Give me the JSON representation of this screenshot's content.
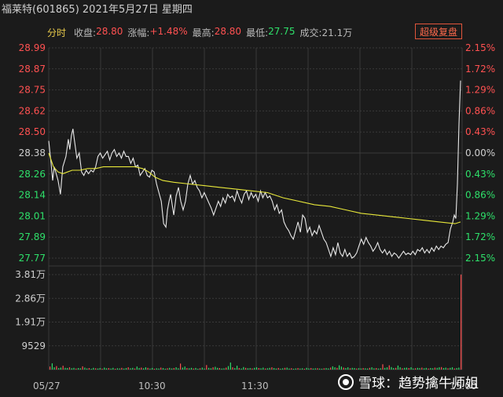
{
  "title": "福莱特(601865) 2021年5月27日 星期四",
  "header": {
    "tab_label": "分时",
    "close_label": "收盘:",
    "close_value": "28.80",
    "change_label": "涨幅:",
    "change_value": "+1.48%",
    "high_label": "最高:",
    "high_value": "28.80",
    "low_label": "最低:",
    "low_value": "27.75",
    "volume_label": "成交:",
    "volume_value": "21.1万",
    "super_button": "超级复盘"
  },
  "colors": {
    "background": "#1b1b1b",
    "grid": "#3a3a3a",
    "up": "#ff5151",
    "down": "#2ee06a",
    "neutral": "#cfcfcf",
    "price_line": "#e8e8e8",
    "avg_line": "#e8e83a"
  },
  "footer": {
    "date_label": "05/27",
    "t1030": "10:30",
    "t1130": "11:30",
    "t1500": "15:00"
  },
  "watermark": "雪球：趋势擒牛师姐",
  "chart_data": [
    {
      "type": "line",
      "prev_close": 28.38,
      "ylim": [
        27.77,
        28.99
      ],
      "y_ticks": [
        "28.99",
        "28.87",
        "28.75",
        "28.62",
        "28.50",
        "28.38",
        "28.26",
        "28.14",
        "28.01",
        "27.89",
        "27.77"
      ],
      "pct_ticks": [
        "2.15%",
        "1.72%",
        "1.29%",
        "0.86%",
        "0.43%",
        "0.00%",
        "0.43%",
        "0.86%",
        "1.29%",
        "1.72%",
        "2.15%"
      ],
      "x_tick_labels": [
        "05/27",
        "10:30",
        "11:30",
        "15:00"
      ],
      "series": [
        {
          "role": "price",
          "points": [
            [
              0,
              28.45
            ],
            [
              3,
              28.32
            ],
            [
              5,
              28.22
            ],
            [
              7,
              28.3
            ],
            [
              9,
              28.27
            ],
            [
              12,
              28.22
            ],
            [
              15,
              28.14
            ],
            [
              18,
              28.3
            ],
            [
              22,
              28.36
            ],
            [
              25,
              28.46
            ],
            [
              27,
              28.4
            ],
            [
              29,
              28.48
            ],
            [
              31,
              28.52
            ],
            [
              33,
              28.45
            ],
            [
              36,
              28.35
            ],
            [
              39,
              28.38
            ],
            [
              42,
              28.27
            ],
            [
              45,
              28.25
            ],
            [
              48,
              28.28
            ],
            [
              51,
              28.26
            ],
            [
              54,
              28.28
            ],
            [
              57,
              28.27
            ],
            [
              60,
              28.3
            ],
            [
              63,
              28.36
            ],
            [
              66,
              28.38
            ],
            [
              69,
              28.35
            ],
            [
              72,
              28.37
            ],
            [
              75,
              28.39
            ],
            [
              78,
              28.34
            ],
            [
              81,
              28.38
            ],
            [
              84,
              28.4
            ],
            [
              87,
              28.36
            ],
            [
              90,
              28.38
            ],
            [
              93,
              28.35
            ],
            [
              96,
              28.39
            ],
            [
              99,
              28.36
            ],
            [
              102,
              28.36
            ],
            [
              105,
              28.32
            ],
            [
              108,
              28.35
            ],
            [
              111,
              28.3
            ],
            [
              114,
              28.31
            ],
            [
              117,
              28.25
            ],
            [
              120,
              28.27
            ],
            [
              123,
              28.29
            ],
            [
              126,
              28.25
            ],
            [
              129,
              28.24
            ],
            [
              132,
              28.28
            ],
            [
              135,
              28.27
            ],
            [
              138,
              28.2
            ],
            [
              141,
              28.15
            ],
            [
              144,
              28.1
            ],
            [
              147,
              27.97
            ],
            [
              150,
              27.95
            ],
            [
              152,
              28.05
            ],
            [
              154,
              28.1
            ],
            [
              156,
              28.14
            ],
            [
              158,
              28.08
            ],
            [
              160,
              28.02
            ],
            [
              163,
              28.13
            ],
            [
              166,
              28.18
            ],
            [
              169,
              28.1
            ],
            [
              172,
              28.05
            ],
            [
              175,
              28.1
            ],
            [
              178,
              28.2
            ],
            [
              181,
              28.25
            ],
            [
              184,
              28.2
            ],
            [
              187,
              28.22
            ],
            [
              190,
              28.18
            ],
            [
              193,
              28.16
            ],
            [
              196,
              28.12
            ],
            [
              199,
              28.15
            ],
            [
              202,
              28.12
            ],
            [
              205,
              28.09
            ],
            [
              208,
              28.06
            ],
            [
              211,
              28.02
            ],
            [
              214,
              28.06
            ],
            [
              217,
              28.1
            ],
            [
              220,
              28.07
            ],
            [
              223,
              28.12
            ],
            [
              226,
              28.09
            ],
            [
              229,
              28.14
            ],
            [
              232,
              28.12
            ],
            [
              235,
              28.13
            ],
            [
              238,
              28.1
            ],
            [
              241,
              28.16
            ],
            [
              244,
              28.12
            ],
            [
              247,
              28.09
            ],
            [
              250,
              28.14
            ],
            [
              253,
              28.16
            ],
            [
              256,
              28.11
            ],
            [
              259,
              28.15
            ],
            [
              262,
              28.12
            ],
            [
              265,
              28.14
            ],
            [
              268,
              28.1
            ],
            [
              271,
              28.16
            ],
            [
              274,
              28.12
            ],
            [
              277,
              28.15
            ],
            [
              280,
              28.12
            ],
            [
              283,
              28.13
            ],
            [
              286,
              28.1
            ],
            [
              289,
              28.05
            ],
            [
              292,
              28.08
            ],
            [
              295,
              28.03
            ],
            [
              298,
              28.05
            ],
            [
              301,
              27.98
            ],
            [
              304,
              27.95
            ],
            [
              307,
              27.93
            ],
            [
              310,
              27.9
            ],
            [
              313,
              27.88
            ],
            [
              316,
              27.93
            ],
            [
              319,
              27.98
            ],
            [
              322,
              27.92
            ],
            [
              325,
              28.02
            ],
            [
              328,
              28.0
            ],
            [
              331,
              27.92
            ],
            [
              334,
              27.95
            ],
            [
              337,
              27.9
            ],
            [
              340,
              27.93
            ],
            [
              343,
              27.91
            ],
            [
              346,
              27.96
            ],
            [
              349,
              27.92
            ],
            [
              352,
              27.88
            ],
            [
              355,
              27.86
            ],
            [
              358,
              27.82
            ],
            [
              361,
              27.78
            ],
            [
              364,
              27.83
            ],
            [
              367,
              27.79
            ],
            [
              370,
              27.86
            ],
            [
              373,
              27.8
            ],
            [
              376,
              27.78
            ],
            [
              379,
              27.82
            ],
            [
              382,
              27.78
            ],
            [
              385,
              27.8
            ],
            [
              388,
              27.77
            ],
            [
              391,
              27.78
            ],
            [
              394,
              27.8
            ],
            [
              397,
              27.84
            ],
            [
              400,
              27.88
            ],
            [
              403,
              27.85
            ],
            [
              406,
              27.89
            ],
            [
              409,
              27.86
            ],
            [
              412,
              27.84
            ],
            [
              415,
              27.81
            ],
            [
              418,
              27.83
            ],
            [
              421,
              27.86
            ],
            [
              424,
              27.82
            ],
            [
              427,
              27.8
            ],
            [
              430,
              27.82
            ],
            [
              433,
              27.79
            ],
            [
              436,
              27.81
            ],
            [
              439,
              27.78
            ],
            [
              442,
              27.8
            ],
            [
              445,
              27.79
            ],
            [
              448,
              27.77
            ],
            [
              451,
              27.79
            ],
            [
              454,
              27.81
            ],
            [
              457,
              27.79
            ],
            [
              460,
              27.8
            ],
            [
              463,
              27.79
            ],
            [
              466,
              27.81
            ],
            [
              469,
              27.79
            ],
            [
              472,
              27.82
            ],
            [
              475,
              27.81
            ],
            [
              478,
              27.83
            ],
            [
              481,
              27.8
            ],
            [
              484,
              27.82
            ],
            [
              487,
              27.8
            ],
            [
              490,
              27.83
            ],
            [
              493,
              27.81
            ],
            [
              496,
              27.84
            ],
            [
              499,
              27.82
            ],
            [
              502,
              27.84
            ],
            [
              505,
              27.83
            ],
            [
              508,
              27.85
            ],
            [
              511,
              27.86
            ],
            [
              514,
              27.94
            ],
            [
              517,
              27.98
            ],
            [
              519,
              28.02
            ],
            [
              521,
              28.0
            ],
            [
              523,
              28.2
            ],
            [
              525,
              28.55
            ],
            [
              527,
              28.8
            ]
          ]
        },
        {
          "role": "average",
          "points": [
            [
              0,
              28.38
            ],
            [
              6,
              28.3
            ],
            [
              12,
              28.27
            ],
            [
              18,
              28.26
            ],
            [
              24,
              28.27
            ],
            [
              30,
              28.28
            ],
            [
              40,
              28.28
            ],
            [
              50,
              28.29
            ],
            [
              60,
              28.29
            ],
            [
              70,
              28.3
            ],
            [
              80,
              28.3
            ],
            [
              90,
              28.3
            ],
            [
              100,
              28.3
            ],
            [
              110,
              28.3
            ],
            [
              120,
              28.29
            ],
            [
              128,
              28.27
            ],
            [
              136,
              28.24
            ],
            [
              146,
              28.22
            ],
            [
              160,
              28.21
            ],
            [
              180,
              28.2
            ],
            [
              200,
              28.19
            ],
            [
              220,
              28.18
            ],
            [
              240,
              28.17
            ],
            [
              260,
              28.16
            ],
            [
              280,
              28.15
            ],
            [
              300,
              28.12
            ],
            [
              320,
              28.1
            ],
            [
              340,
              28.08
            ],
            [
              360,
              28.07
            ],
            [
              380,
              28.05
            ],
            [
              400,
              28.03
            ],
            [
              420,
              28.02
            ],
            [
              440,
              28.01
            ],
            [
              460,
              28.0
            ],
            [
              480,
              27.99
            ],
            [
              500,
              27.98
            ],
            [
              520,
              27.97
            ],
            [
              527,
              27.98
            ]
          ]
        }
      ],
      "x_max": 527
    },
    {
      "type": "bar",
      "ylim": [
        0,
        38100
      ],
      "y_ticks": [
        "3.81万",
        "2.86万",
        "1.91万",
        "9529"
      ],
      "values": [
        1200,
        2500,
        900,
        1400,
        600,
        800,
        1500,
        700,
        600,
        900,
        500,
        700,
        400,
        600,
        500,
        1300,
        800,
        450,
        600,
        300,
        700,
        500,
        400,
        600,
        350,
        800,
        500,
        600,
        400,
        700,
        300,
        500,
        450,
        700,
        400,
        600,
        900,
        500,
        700,
        400,
        1200,
        600,
        800,
        500,
        900,
        700,
        400,
        650,
        300,
        500,
        400,
        800,
        600,
        350,
        500,
        700,
        450,
        600,
        900,
        500,
        2400,
        800,
        1200,
        600,
        500,
        700,
        400,
        650,
        300,
        500,
        800,
        400,
        1800,
        700,
        500,
        900,
        1100,
        700,
        600,
        400,
        500,
        800,
        1400,
        2800,
        900,
        600,
        1500,
        600,
        400,
        1000,
        700,
        500,
        600,
        450,
        700,
        900,
        600,
        500,
        800,
        400,
        500,
        700,
        900,
        600,
        400,
        650,
        350,
        500,
        700,
        800,
        400,
        550,
        300,
        450,
        600,
        400,
        500,
        300,
        700,
        450,
        600,
        400,
        500,
        550,
        400,
        350,
        500,
        600,
        450,
        800,
        1300,
        900,
        700,
        1700,
        1200,
        800,
        600,
        900,
        500,
        700,
        600,
        400,
        550,
        450,
        600,
        500,
        400,
        700,
        900,
        500,
        600,
        400,
        500,
        2100,
        700,
        900,
        1700,
        1000,
        600,
        700,
        1600,
        900,
        500,
        700,
        800,
        600,
        900,
        400,
        500,
        700,
        600,
        800,
        500,
        700,
        400,
        600,
        500,
        800,
        700,
        900,
        1000,
        600,
        800,
        500,
        700,
        900,
        400,
        600,
        800,
        38100
      ]
    }
  ]
}
